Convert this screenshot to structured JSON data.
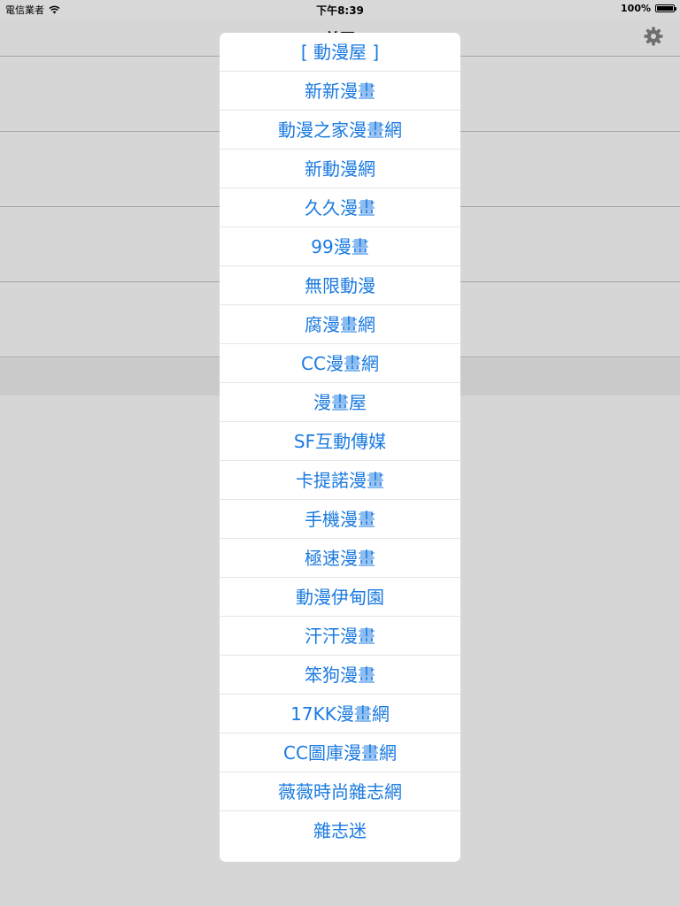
{
  "status_bar": {
    "carrier": "電信業者",
    "time": "下午8:39",
    "battery_percent": "100%",
    "battery_level": 1.0
  },
  "nav_bar": {
    "title": "首頁",
    "settings_icon": "gear-icon"
  },
  "menu": {
    "items": [
      "[ 動漫屋 ]",
      "新新漫畫",
      "動漫之家漫畫網",
      "新動漫網",
      "久久漫畫",
      "99漫畫",
      "無限動漫",
      "腐漫畫網",
      "CC漫畫網",
      "漫畫屋",
      "SF互動傳媒",
      "卡提諾漫畫",
      "手機漫畫",
      "極速漫畫",
      "動漫伊甸園",
      "汗汗漫畫",
      "笨狗漫畫",
      "17KK漫畫網",
      "CC圖庫漫畫網",
      "薇薇時尚雜志網",
      "雜志迷"
    ]
  },
  "colors": {
    "accent": "#1a7ae0",
    "background": "#d6d6d6",
    "popover": "#ffffff"
  }
}
